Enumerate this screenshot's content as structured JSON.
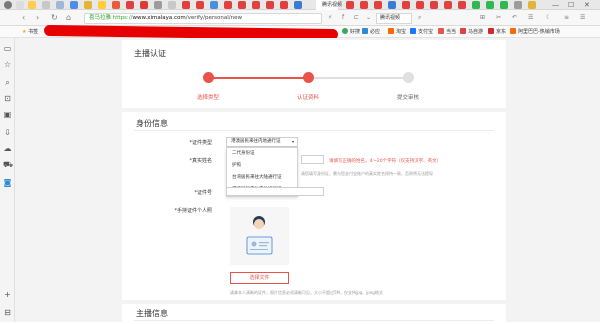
{
  "browser": {
    "tab_title": "喜马拉雅",
    "active_tab_label": "腾讯视频",
    "url_secure_label": "喜马拉雅",
    "url_prefix": "https://",
    "url_domain": "www.ximalaya.com",
    "url_path": "/verify/personal/new",
    "window_controls": [
      "—",
      "☐",
      "✕"
    ]
  },
  "bookmarks": {
    "label": "书签",
    "items": [
      "好搜",
      "必应",
      "淘宝",
      "支付宝",
      "当当",
      "马自游",
      "京东",
      "阿里巴巴-热销市场"
    ]
  },
  "page": {
    "title": "主播认证",
    "steps": [
      {
        "label": "选择类型",
        "state": "done"
      },
      {
        "label": "认证资料",
        "state": "current"
      },
      {
        "label": "提交审核",
        "state": "todo"
      }
    ],
    "identity_section_title": "身份信息",
    "fields": {
      "id_type_label": "*证件类型",
      "real_name_label": "*真实姓名",
      "id_number_label": "*证件号",
      "id_photo_label": "*手持证件个人照"
    },
    "id_type_select": {
      "value": "港澳居民来往内地通行证",
      "options": [
        "二代身份证",
        "护照",
        "台湾居民来往大陆通行证",
        "港澳居民来往内地通行证"
      ]
    },
    "name_hint": "请填写正确的姓名，4～20个字符（仅支持汉字、英文）",
    "name_hint_secondary": "请您填写身份证，需与您支付宝账户的真实姓名保持一致，否则将无法提现",
    "upload_button": "选择文件",
    "upload_hint": "请拿本人清晰的证件，照片信息必须清晰可见，大小不超过5M，仅支持jpg、jpeg格式",
    "anchor_section_title": "主播信息"
  },
  "colors": {
    "accent": "#e8534a",
    "step_inactive": "#e0e0e0",
    "redaction": "#e60000"
  }
}
